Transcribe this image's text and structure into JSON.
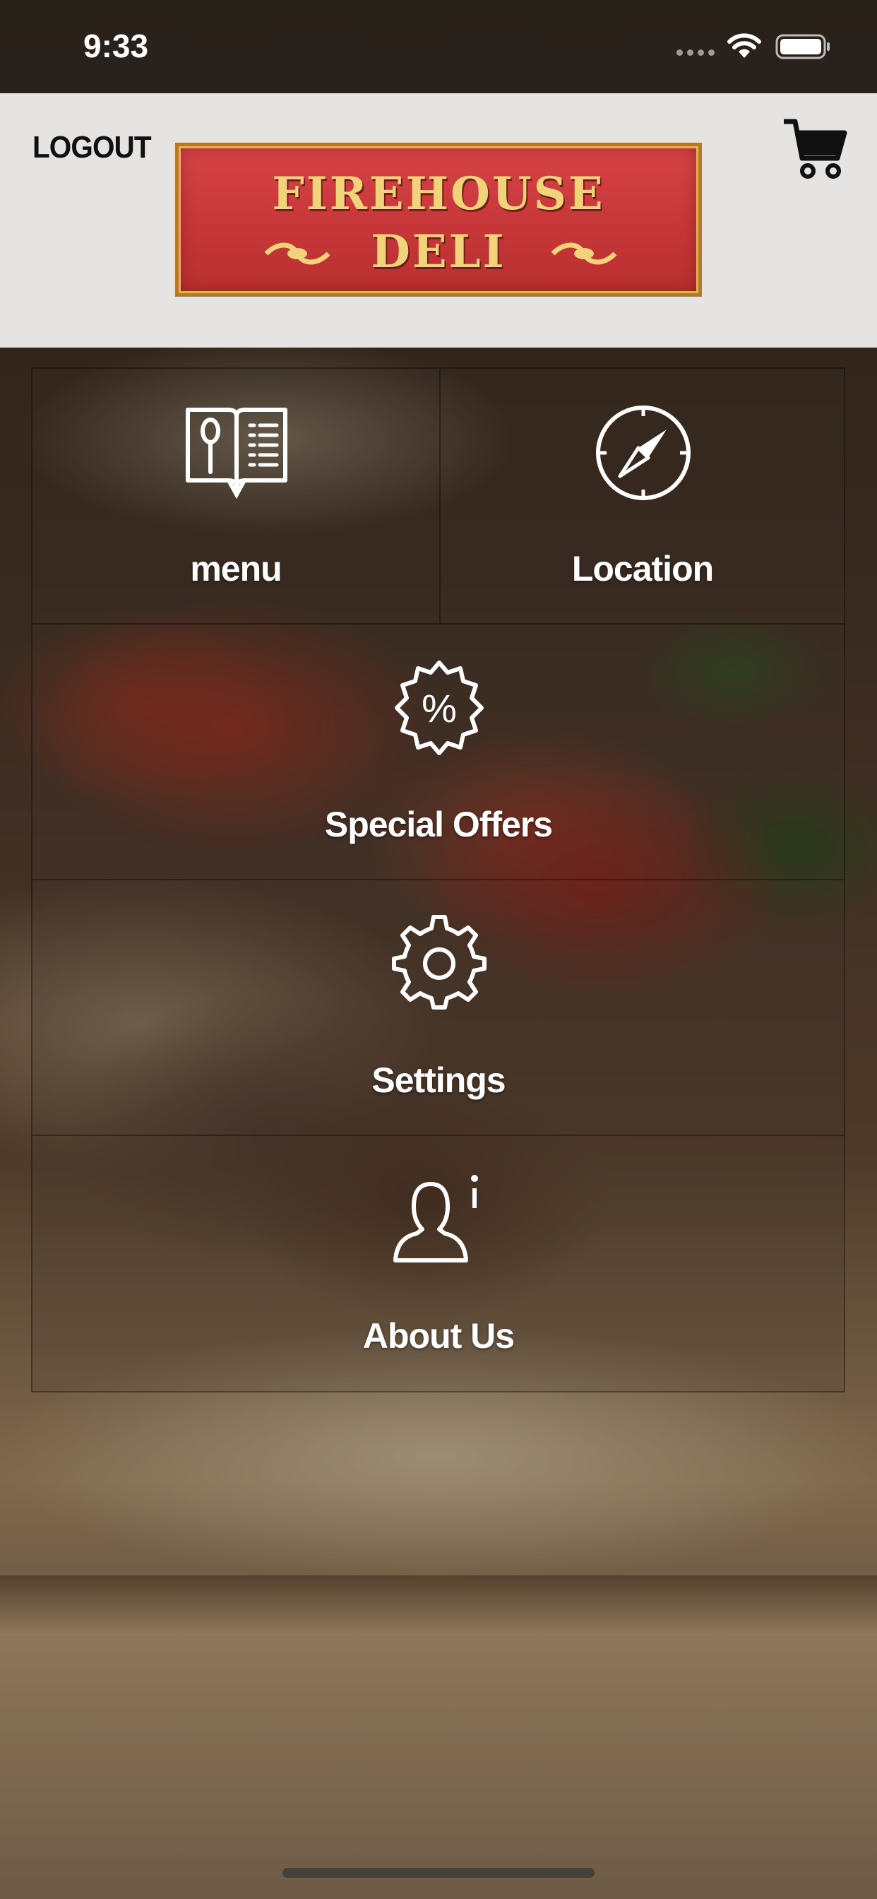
{
  "status_bar": {
    "time": "9:33"
  },
  "header": {
    "logout_label": "LOGOUT",
    "logo": {
      "line1": "FIREHOUSE",
      "line2": "DELI"
    }
  },
  "tiles": [
    {
      "label": "menu",
      "icon": "menu-book-icon"
    },
    {
      "label": "Location",
      "icon": "compass-icon"
    },
    {
      "label": "Special Offers",
      "icon": "percent-badge-icon"
    },
    {
      "label": "Settings",
      "icon": "gear-icon"
    },
    {
      "label": "About Us",
      "icon": "person-info-icon"
    }
  ],
  "colors": {
    "header_bg": "#e6e4e2",
    "logo_red": "#c8373a",
    "logo_gold": "#f2d27a",
    "tile_text": "#ffffff"
  }
}
